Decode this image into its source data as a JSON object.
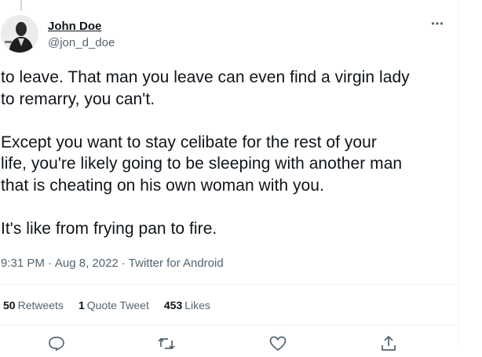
{
  "user": {
    "display_name": "John Doe",
    "handle": "@jon_d_doe"
  },
  "tweet": {
    "paragraphs": [
      "to leave. That man you leave can even find a virgin lady\nto remarry, you can't.",
      "Except you want to stay celibate for the rest of your\nlife, you're likely going to be sleeping with another man\nthat is cheating on his own woman with you.",
      "It's like from frying pan to fire."
    ],
    "time": "9:31 PM",
    "date": "Aug 8, 2022",
    "source": "Twitter for Android",
    "separator": "·"
  },
  "stats": {
    "retweets_count": "50",
    "retweets_label": "Retweets",
    "quotes_count": "1",
    "quotes_label": "Quote Tweet",
    "likes_count": "453",
    "likes_label": "Likes"
  },
  "icons": {
    "more": "more-dots-icon",
    "reply": "reply-icon",
    "retweet": "retweet-icon",
    "like": "heart-icon",
    "share": "share-icon"
  },
  "colors": {
    "text": "#0f1419",
    "secondary": "#536471",
    "border": "#eff3f4"
  }
}
